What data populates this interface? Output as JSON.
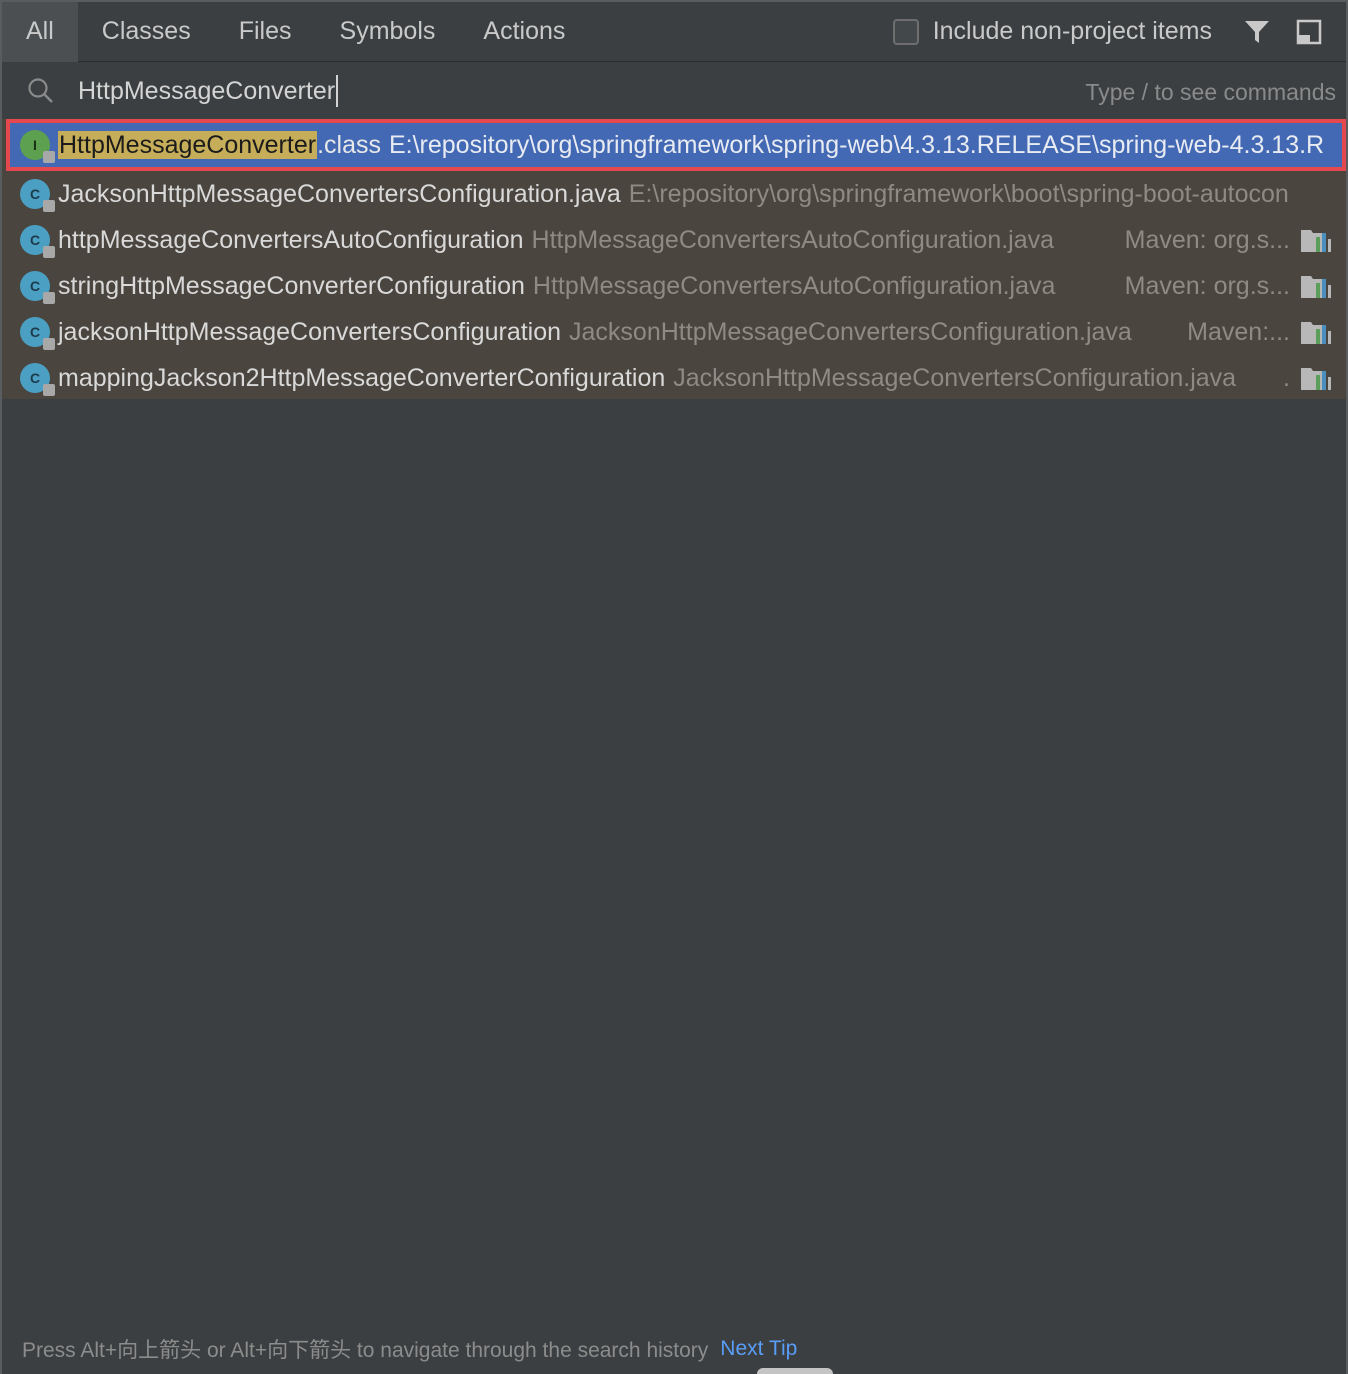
{
  "tabs": [
    {
      "label": "All",
      "active": true
    },
    {
      "label": "Classes"
    },
    {
      "label": "Files"
    },
    {
      "label": "Symbols"
    },
    {
      "label": "Actions"
    }
  ],
  "include_checkbox": {
    "label": "Include non-project items",
    "checked": false
  },
  "toolbar_icons": [
    "filter-icon",
    "window-icon"
  ],
  "search": {
    "value": "HttpMessageConverter",
    "hint": "Type / to see commands"
  },
  "results": [
    {
      "icon": "interface-icon",
      "icon_letter": "I",
      "name_highlight": "HttpMessageConverter",
      "name_rest": ".class",
      "location": "E:\\repository\\org\\springframework\\spring-web\\4.3.13.RELEASE\\spring-web-4.3.13.R",
      "selected": true
    },
    {
      "icon": "class-icon",
      "icon_letter": "C",
      "name": "JacksonHttpMessageConvertersConfiguration.java",
      "location": "E:\\repository\\org\\springframework\\boot\\spring-boot-autocon"
    },
    {
      "icon": "class-icon",
      "icon_letter": "C",
      "name": "httpMessageConvertersAutoConfiguration",
      "location": "HttpMessageConvertersAutoConfiguration.java",
      "maven": "Maven: org.s..."
    },
    {
      "icon": "class-icon",
      "icon_letter": "C",
      "name": "stringHttpMessageConverterConfiguration",
      "location": "HttpMessageConvertersAutoConfiguration.java",
      "maven": "Maven: org.s..."
    },
    {
      "icon": "class-icon",
      "icon_letter": "C",
      "name": "jacksonHttpMessageConvertersConfiguration",
      "location": "JacksonHttpMessageConvertersConfiguration.java",
      "maven": "Maven:..."
    },
    {
      "icon": "class-icon",
      "icon_letter": "C",
      "name": "mappingJackson2HttpMessageConverterConfiguration",
      "location": "JacksonHttpMessageConvertersConfiguration.java",
      "maven": "."
    }
  ],
  "footer": {
    "tip": "Press Alt+向上箭头 or Alt+向下箭头 to navigate through the search history",
    "next_tip": "Next Tip"
  },
  "colors": {
    "selection": "#4369b4",
    "selection_border": "#e5484d",
    "match_highlight": "#c6ad59",
    "link": "#589df6"
  }
}
